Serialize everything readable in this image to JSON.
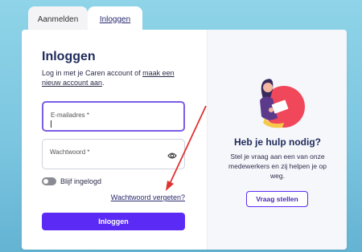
{
  "tabs": [
    {
      "label": "Aanmelden"
    },
    {
      "label": "Inloggen"
    }
  ],
  "login": {
    "title": "Inloggen",
    "intro_prefix": "Log in met je Caren account of ",
    "intro_link": "maak een nieuw account aan",
    "intro_suffix": ".",
    "email_label": "E-mailadres *",
    "password_label": "Wachtwoord *",
    "remember_label": "Blijf ingelogd",
    "remember_checked": false,
    "forgot_link": "Wachtwoord vergeten?",
    "submit_label": "Inloggen"
  },
  "help": {
    "title": "Heb je hulp nodig?",
    "text": "Stel je vraag aan een van onze medewerkers en zij helpen je op weg.",
    "button_label": "Vraag stellen"
  },
  "icons": [
    "eye-icon",
    "woman-with-laptop-illustration",
    "red-arrow-annotation"
  ],
  "colors": {
    "accent": "#5b2bf5",
    "focus_border": "#7b5ce6",
    "heading": "#1f2a5a",
    "annotation": "#e03131"
  }
}
